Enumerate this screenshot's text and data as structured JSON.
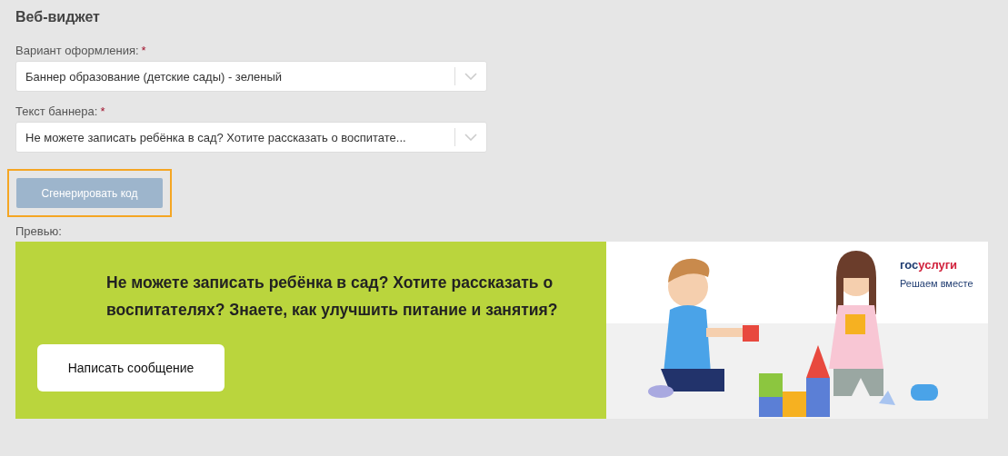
{
  "title": "Веб-виджет",
  "fields": [
    {
      "label": "Вариант оформления:",
      "required_mark": "*",
      "value": "Баннер образование (детские сады) - зеленый"
    },
    {
      "label": "Текст баннера:",
      "required_mark": "*",
      "value": "Не можете записать ребёнка в сад? Хотите рассказать о воспитате..."
    }
  ],
  "generate_button": {
    "label": "Сгенерировать код",
    "disabled": true,
    "focused": true
  },
  "preview_label": "Превью:",
  "banner": {
    "headline": "Не можете записать ребёнка в сад? Хотите рассказать о воспитателях? Знаете, как улучшить питание и занятия?",
    "button": "Написать сообщение",
    "logo": "госуслуги",
    "slogan": "Решаем вместе"
  }
}
